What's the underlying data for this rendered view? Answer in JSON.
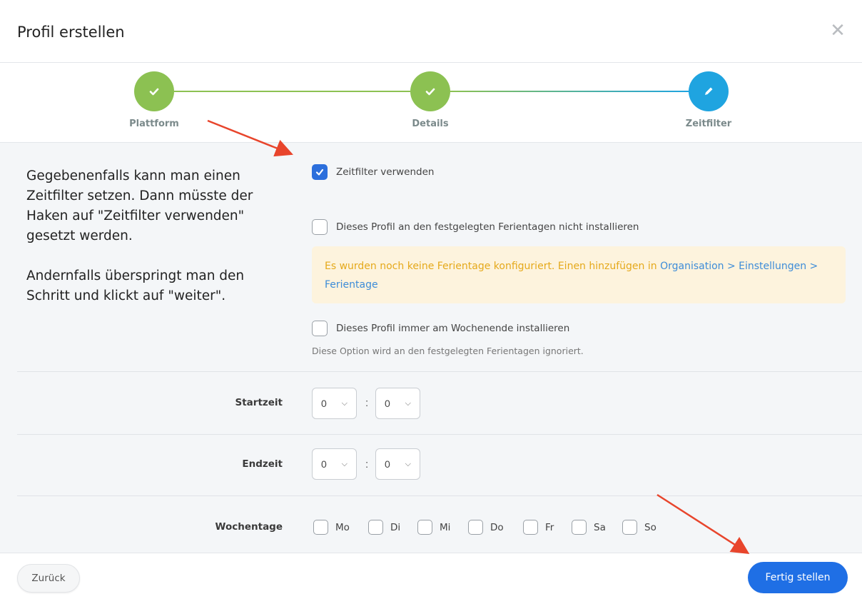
{
  "dialog": {
    "title": "Profil erstellen",
    "close_icon": "close-icon"
  },
  "stepper": {
    "steps": [
      {
        "label": "Plattform",
        "state": "done",
        "icon": "check-icon"
      },
      {
        "label": "Details",
        "state": "done",
        "icon": "check-icon"
      },
      {
        "label": "Zeitfilter",
        "state": "active",
        "icon": "pencil-icon"
      }
    ],
    "colors": {
      "done": "#8cc152",
      "active": "#1fa4e0"
    }
  },
  "explanation": {
    "paragraph1": "Gegebenenfalls kann man einen Zeitfilter setzen. Dann müsste der Haken auf \"Zeitfilter verwenden\" gesetzt werden.",
    "paragraph2": "Andernfalls überspringt man den Schritt und klickt auf \"weiter\"."
  },
  "options": {
    "use_time_filter": {
      "label": "Zeitfilter verwenden",
      "checked": true
    },
    "skip_holidays": {
      "label": "Dieses Profil an den festgelegten Ferientagen nicht installieren",
      "checked": false
    },
    "warning": {
      "text": "Es wurden noch keine Ferientage konfiguriert. Einen hinzufügen in ",
      "link": "Organisation > Einstellungen > Ferientage"
    },
    "weekend": {
      "label": "Dieses Profil immer am Wochenende installieren",
      "checked": false
    },
    "weekend_hint": "Diese Option wird an den festgelegten Ferientagen ignoriert."
  },
  "start_time": {
    "label": "Startzeit",
    "hour": "0",
    "minute": "0",
    "separator": ":"
  },
  "end_time": {
    "label": "Endzeit",
    "hour": "0",
    "minute": "0",
    "separator": ":"
  },
  "weekdays": {
    "label": "Wochentage",
    "days": [
      {
        "label": "Mo",
        "checked": false
      },
      {
        "label": "Di",
        "checked": false
      },
      {
        "label": "Mi",
        "checked": false
      },
      {
        "label": "Do",
        "checked": false
      },
      {
        "label": "Fr",
        "checked": false
      },
      {
        "label": "Sa",
        "checked": false
      },
      {
        "label": "So",
        "checked": false
      }
    ]
  },
  "footer": {
    "back_label": "Zurück",
    "finish_label": "Fertig stellen",
    "finish_color": "#1f6fe5"
  },
  "annotations": {
    "arrow_color": "#e8452c"
  }
}
